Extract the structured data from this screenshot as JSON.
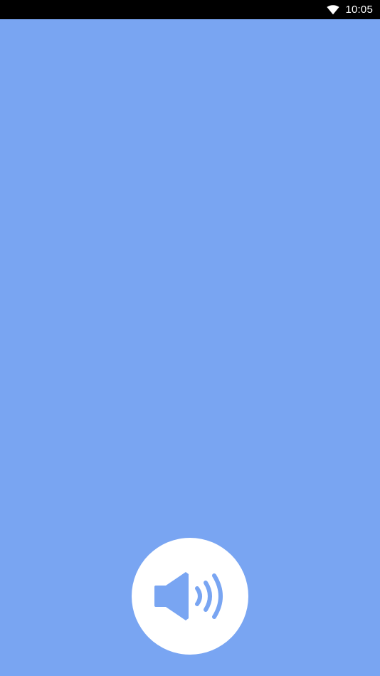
{
  "status_bar": {
    "time": "10:05",
    "wifi_icon": "wifi-icon"
  },
  "main": {
    "background_color": "#79a5f2",
    "speaker_button": {
      "icon": "speaker-volume-icon",
      "button_color": "#ffffff",
      "icon_color": "#79a5f2"
    }
  }
}
